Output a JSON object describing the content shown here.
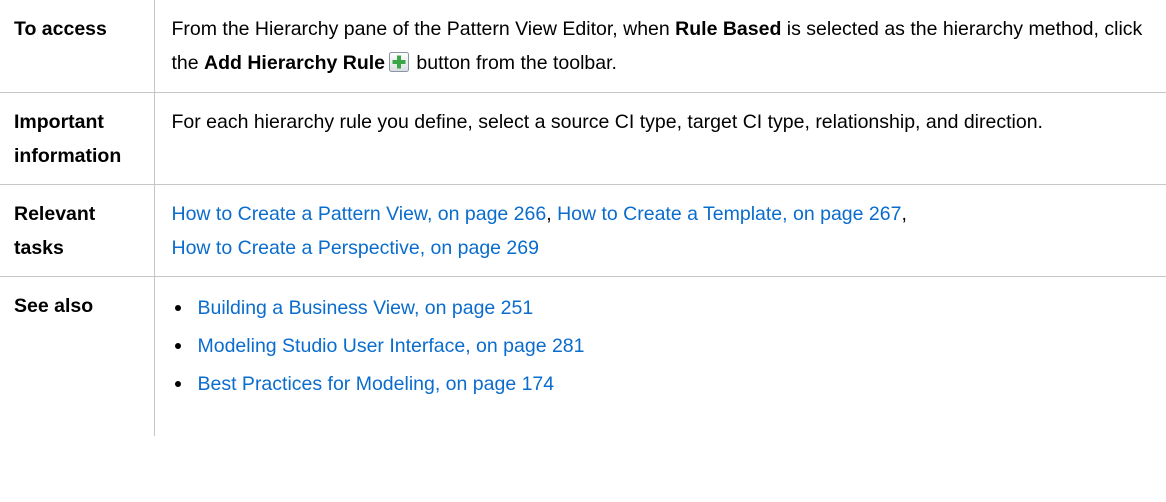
{
  "rows": {
    "access": {
      "label": "To access",
      "text1": "From the Hierarchy pane of the Pattern View Editor, when ",
      "bold1": "Rule Based",
      "text2": " is selected as the hierarchy method, click the ",
      "bold2": "Add Hierarchy Rule",
      "text3": " button from the toolbar.",
      "icon": "add-plus-icon"
    },
    "important": {
      "label_line1": "Important",
      "label_line2": "information",
      "text": "For each hierarchy rule you define, select a source CI type, target CI type, relationship, and direction."
    },
    "tasks": {
      "label_line1": "Relevant",
      "label_line2": "tasks",
      "links": [
        "How to Create a Pattern View, on page 266",
        "How to Create a Template, on page 267",
        "How to Create a Perspective, on page 269"
      ],
      "separator": ", "
    },
    "see_also": {
      "label": "See also",
      "links": [
        "Building a Business View, on page 251",
        "Modeling Studio User Interface, on page 281",
        "Best Practices for Modeling, on page 174"
      ]
    }
  },
  "colors": {
    "link": "#0a6ccd",
    "border": "#c6c6c6",
    "icon_green": "#3aa64a"
  }
}
